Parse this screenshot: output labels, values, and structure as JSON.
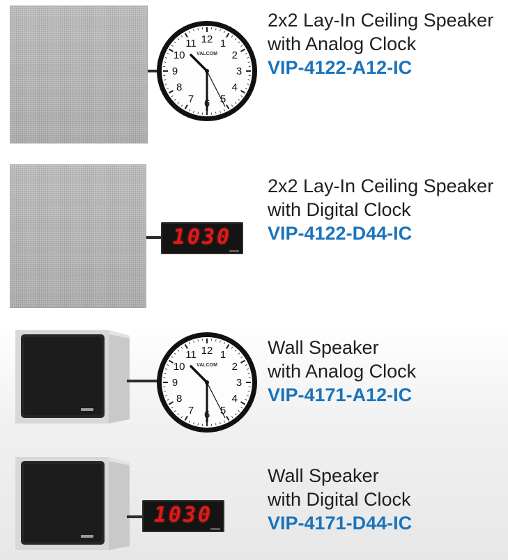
{
  "products": [
    {
      "title": "2x2 Lay-In Ceiling Speaker",
      "subtitle": "with Analog Clock",
      "model": "VIP-4122-A12-IC",
      "speaker_type": "ceiling",
      "clock_type": "analog"
    },
    {
      "title": "2x2 Lay-In Ceiling Speaker",
      "subtitle": "with Digital Clock",
      "model": "VIP-4122-D44-IC",
      "speaker_type": "ceiling",
      "clock_type": "digital"
    },
    {
      "title": "Wall Speaker",
      "subtitle": "with Analog Clock",
      "model": "VIP-4171-A12-IC",
      "speaker_type": "wall",
      "clock_type": "analog"
    },
    {
      "title": "Wall Speaker",
      "subtitle": "with Digital Clock",
      "model": "VIP-4171-D44-IC",
      "speaker_type": "wall",
      "clock_type": "digital"
    }
  ],
  "clock": {
    "brand": "VALCOM",
    "numerals": [
      "12",
      "1",
      "2",
      "3",
      "4",
      "5",
      "6",
      "7",
      "8",
      "9",
      "10",
      "11"
    ],
    "digital_time": "10:30",
    "digital_display": "1030"
  },
  "colors": {
    "model_text": "#1a73bb",
    "body_text": "#1f1f1f",
    "digital_led": "#e01a1a"
  }
}
